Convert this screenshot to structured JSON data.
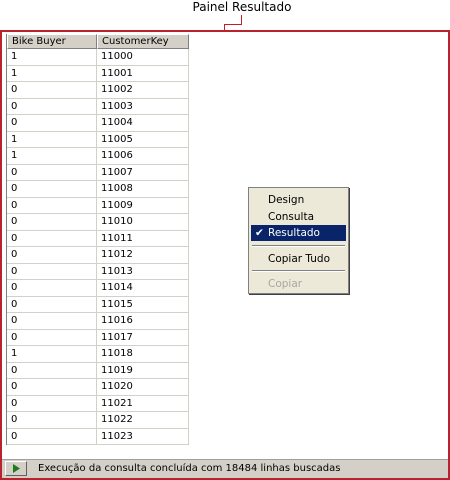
{
  "callout": {
    "label": "Painel Resultado"
  },
  "grid": {
    "columns": [
      "Bike Buyer",
      "CustomerKey"
    ],
    "rows": [
      [
        "1",
        "11000"
      ],
      [
        "1",
        "11001"
      ],
      [
        "0",
        "11002"
      ],
      [
        "0",
        "11003"
      ],
      [
        "0",
        "11004"
      ],
      [
        "1",
        "11005"
      ],
      [
        "1",
        "11006"
      ],
      [
        "0",
        "11007"
      ],
      [
        "0",
        "11008"
      ],
      [
        "0",
        "11009"
      ],
      [
        "0",
        "11010"
      ],
      [
        "0",
        "11011"
      ],
      [
        "0",
        "11012"
      ],
      [
        "0",
        "11013"
      ],
      [
        "0",
        "11014"
      ],
      [
        "0",
        "11015"
      ],
      [
        "0",
        "11016"
      ],
      [
        "0",
        "11017"
      ],
      [
        "1",
        "11018"
      ],
      [
        "0",
        "11019"
      ],
      [
        "0",
        "11020"
      ],
      [
        "0",
        "11021"
      ],
      [
        "0",
        "11022"
      ],
      [
        "0",
        "11023"
      ]
    ]
  },
  "context_menu": {
    "items": [
      {
        "label": "Design",
        "checked": false,
        "selected": false,
        "disabled": false
      },
      {
        "label": "Consulta",
        "checked": false,
        "selected": false,
        "disabled": false
      },
      {
        "label": "Resultado",
        "checked": true,
        "selected": true,
        "disabled": false
      },
      {
        "label": "Copiar Tudo",
        "checked": false,
        "selected": false,
        "disabled": false
      },
      {
        "label": "Copiar",
        "checked": false,
        "selected": false,
        "disabled": true
      }
    ],
    "check_glyph": "✔"
  },
  "status": {
    "text": "Execução da consulta concluída com 18484 linhas buscadas",
    "play_icon": "play-icon"
  },
  "colors": {
    "accent_border": "#b8232e",
    "selection": "#0a246a",
    "play_green": "#1f7a1f"
  }
}
